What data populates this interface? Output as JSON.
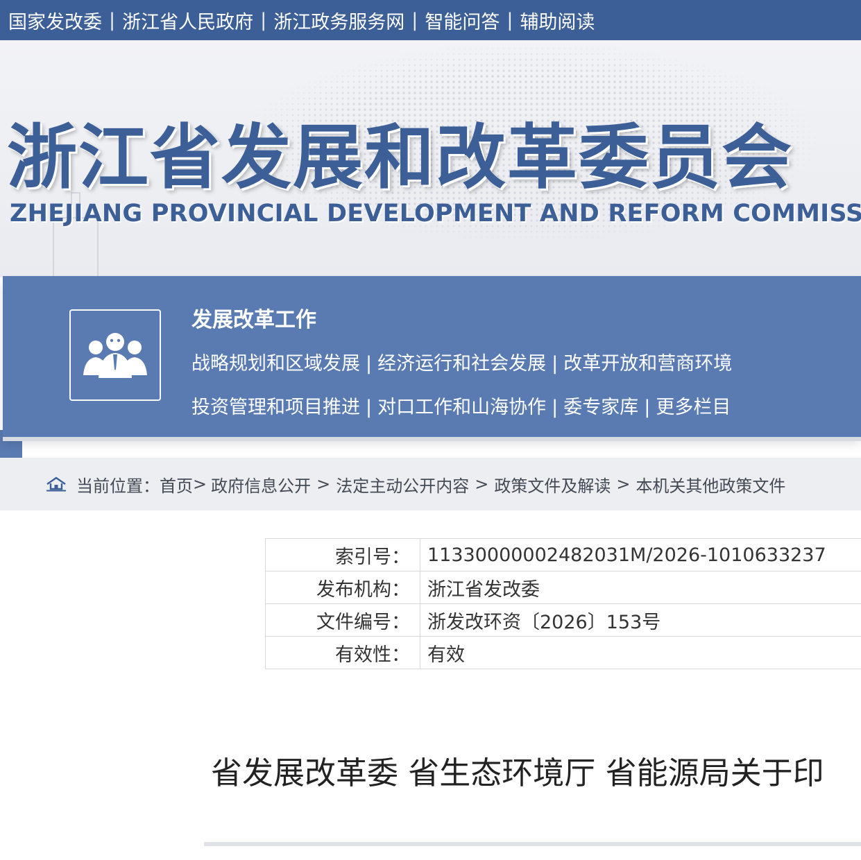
{
  "topbar": {
    "links": [
      "国家发改委",
      "浙江省人民政府",
      "浙江政务服务网",
      "智能问答",
      "辅助阅读"
    ],
    "separator": "|"
  },
  "header": {
    "title": "浙江省发展和改革委员会",
    "subtitle": "ZHEJIANG PROVINCIAL DEVELOPMENT AND REFORM COMMISSION"
  },
  "nav": {
    "icon": "people-group-icon",
    "heading": "发展改革工作",
    "row1": [
      "战略规划和区域发展",
      "经济运行和社会发展",
      "改革开放和营商环境"
    ],
    "row2": [
      "投资管理和项目推进",
      "对口工作和山海协作",
      "委专家库",
      "更多栏目"
    ],
    "separator": "|"
  },
  "breadcrumb": {
    "icon": "home-icon",
    "label": "当前位置：",
    "items": [
      "首页",
      "政府信息公开",
      "法定主动公开内容",
      "政策文件及解读",
      "本机关其他政策文件"
    ],
    "arrow": ">"
  },
  "info": {
    "rows": [
      {
        "key": "索引号：",
        "value": "11330000002482031M/2026-1010633237"
      },
      {
        "key": "发布机构：",
        "value": "浙江省发改委"
      },
      {
        "key": "文件编号：",
        "value": "浙发改环资〔2026〕153号"
      },
      {
        "key": "有效性：",
        "value": "有效"
      }
    ]
  },
  "document": {
    "title": "省发展改革委 省生态环境厅 省能源局关于印"
  },
  "colors": {
    "primary": "#3d5f97",
    "nav_panel": "#5a7bb2",
    "breadcrumb_bg": "#eceef2",
    "border": "#d5d8dd"
  }
}
